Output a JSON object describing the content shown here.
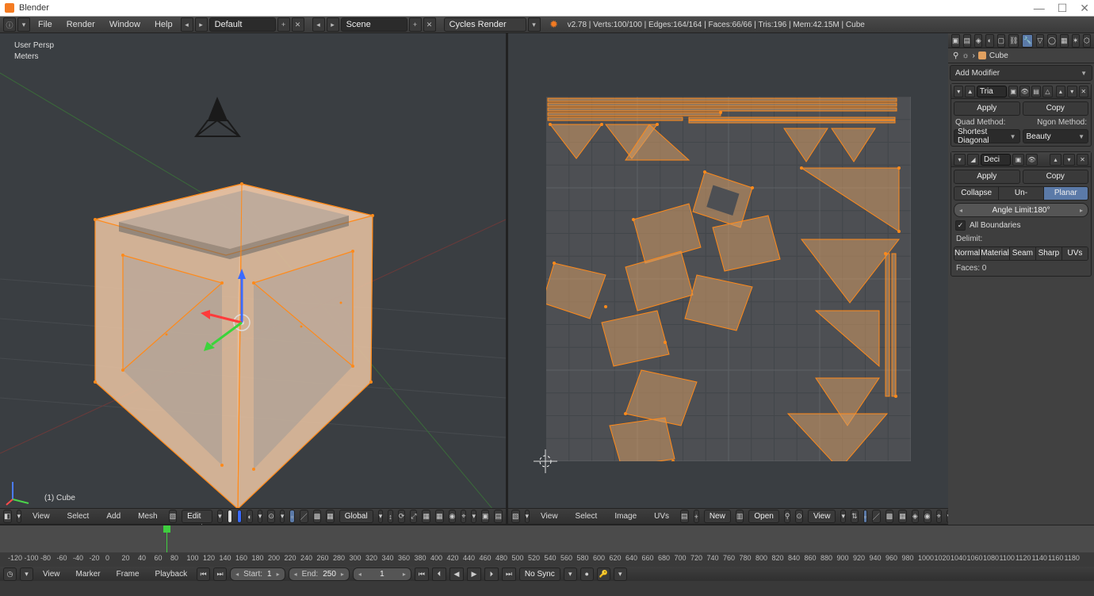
{
  "window": {
    "title": "Blender",
    "minimize": "—",
    "maximize": "☐",
    "close": "✕"
  },
  "menubar": {
    "items": [
      "File",
      "Render",
      "Window",
      "Help"
    ],
    "layout": "Default",
    "scene": "Scene",
    "renderer": "Cycles Render",
    "stats": "v2.78 | Verts:100/100 | Edges:164/164 | Faces:66/66 | Tris:196 | Mem:42.15M | Cube"
  },
  "view3d": {
    "persp": "User Persp",
    "units": "Meters",
    "object_name": "(1) Cube",
    "header": {
      "menus": [
        "View",
        "Select",
        "Add",
        "Mesh"
      ],
      "mode": "Edit Mode",
      "orientation": "Global"
    }
  },
  "uv": {
    "header": {
      "menus": [
        "View",
        "Select",
        "Image",
        "UVs"
      ],
      "new": "New",
      "open": "Open",
      "view_label": "View"
    }
  },
  "timeline": {
    "header": {
      "menus": [
        "View",
        "Marker",
        "Frame",
        "Playback"
      ],
      "start_label": "Start:",
      "start_val": "1",
      "end_label": "End:",
      "end_val": "250",
      "current": "1",
      "sync": "No Sync"
    },
    "ticks": [
      "-120",
      "-100",
      "-80",
      "-60",
      "-40",
      "-20",
      "0",
      "20",
      "40",
      "60",
      "80",
      "100",
      "120",
      "140",
      "160",
      "180",
      "200",
      "220",
      "240",
      "260",
      "280",
      "300",
      "320",
      "340",
      "360",
      "380",
      "400",
      "420",
      "440",
      "460",
      "480",
      "500",
      "520",
      "540",
      "560",
      "580",
      "600",
      "620",
      "640",
      "660",
      "680",
      "700",
      "720",
      "740",
      "760",
      "780",
      "800",
      "820",
      "840",
      "860",
      "880",
      "900",
      "920",
      "940",
      "960",
      "980",
      "1000",
      "1020",
      "1040",
      "1060",
      "1080",
      "1100",
      "1120",
      "1140",
      "1160",
      "1180"
    ]
  },
  "props": {
    "object": "Cube",
    "add_modifier": "Add Modifier",
    "mod1": {
      "name": "Tria",
      "apply": "Apply",
      "copy": "Copy",
      "quad_label": "Quad Method:",
      "ngon_label": "Ngon Method:",
      "quad_value": "Shortest Diagonal",
      "ngon_value": "Beauty"
    },
    "mod2": {
      "name": "Deci",
      "apply": "Apply",
      "copy": "Copy",
      "tabs": [
        "Collapse",
        "Un-Subdivide",
        "Planar"
      ],
      "angle_label": "Angle Limit:",
      "angle_value": "180°",
      "all_boundaries": "All Boundaries",
      "delimit": "Delimit:",
      "delimit_opts": [
        "Normal",
        "Material",
        "Seam",
        "Sharp",
        "UVs"
      ],
      "faces": "Faces: 0"
    }
  }
}
